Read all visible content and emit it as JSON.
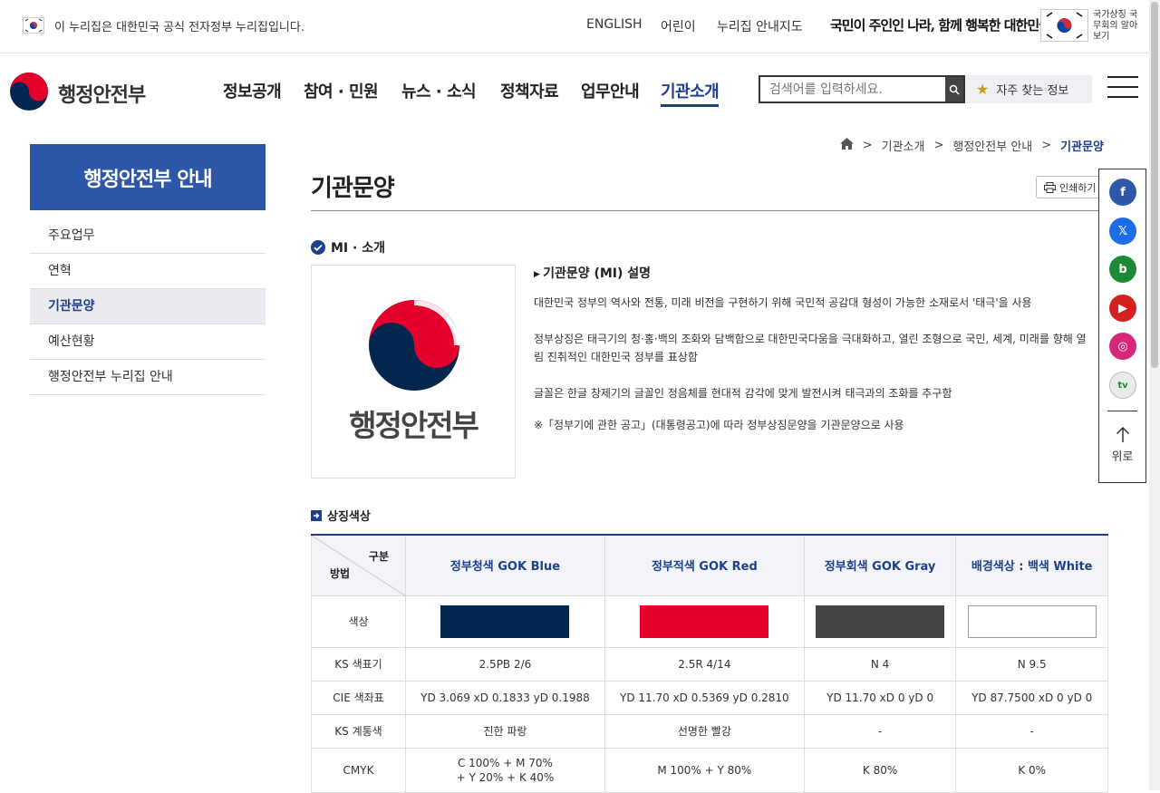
{
  "topbar": {
    "official_notice": "이 누리집은 대한민국 공식 전자정부 누리집입니다.",
    "links": [
      "ENGLISH",
      "어린이",
      "누리집 안내지도"
    ],
    "slogan": "국민이 주인인 나라, 함께 행복한 대한민국",
    "cabinet_label": "국가상징 국무회의 알아보기"
  },
  "header": {
    "logo_text": "행정안전부",
    "gnb": [
      "정보공개",
      "참여 · 민원",
      "뉴스 · 소식",
      "정책자료",
      "업무안내",
      "기관소개"
    ],
    "search_placeholder": "검색어를 입력하세요.",
    "frequent_label": "자주 찾는 정보"
  },
  "lnb": {
    "title": "행정안전부 안내",
    "items": [
      "주요업무",
      "연혁",
      "기관문양",
      "예산현황",
      "행정안전부 누리집 안내"
    ],
    "active_index": 2
  },
  "breadcrumb": [
    "기관소개",
    "행정안전부 안내",
    "기관문양"
  ],
  "page": {
    "title": "기관문양",
    "print_label": "인쇄하기",
    "section_mi": "MI · 소개",
    "logo_caption": "행정안전부",
    "desc_head": "기관문양 (MI) 설명",
    "desc": [
      "대한민국 정부의 역사와 전통, 미래 비전을 구현하기 위해 국민적 공감대 형성이 가능한 소재로서 '태극'을 사용",
      "정부상징은 태극기의 청·홍·백의 조화와 담백함으로 대한민국다움을 극대화하고, 열린 조형으로 국민, 세계, 미래를 향해 열림 진취적인 대한민국 정부를 표상함",
      "글꼴은 한글 창제기의 글꼴인 정음체를 현대적 감각에 맞게 발전시켜 태극과의 조화를 추구함",
      "※「정부기에 관한 공고」(대통령공고)에 따라 정부상징문양을 기관문양으로 사용"
    ],
    "section_color": "상징색상"
  },
  "table": {
    "corner_top": "구분",
    "corner_bottom": "방법",
    "columns": [
      "정부청색 GOK Blue",
      "정부적색 GOK Red",
      "정부회색 GOK Gray",
      "배경색상 : 백색 White"
    ],
    "swatch_colors": [
      "#02274f",
      "#e4002b",
      "#444447",
      "#ffffff"
    ],
    "rows": [
      {
        "label": "색상",
        "values": [
          "",
          "",
          "",
          ""
        ]
      },
      {
        "label": "KS 색표기",
        "values": [
          "2.5PB 2/6",
          "2.5R 4/14",
          "N 4",
          "N 9.5"
        ]
      },
      {
        "label": "CIE 색좌표",
        "values": [
          "YD 3.069 xD 0.1833 yD 0.1988",
          "YD 11.70 xD 0.5369 yD 0.2810",
          "YD 11.70 xD 0 yD 0",
          "YD 87.7500 xD 0 yD 0"
        ]
      },
      {
        "label": "KS 계통색",
        "values": [
          "진한 파랑",
          "선명한 빨강",
          "-",
          "-"
        ]
      },
      {
        "label": "CMYK",
        "values": [
          "C 100% + M 70% + Y 20% + K 40%",
          "M 100% + Y 80%",
          "K 80%",
          "K 0%"
        ]
      }
    ]
  },
  "sidebar": {
    "sns": [
      {
        "name": "facebook",
        "glyph": "f",
        "color": "#2f57a8"
      },
      {
        "name": "x",
        "glyph": "𝕏",
        "color": "#1c6ee8"
      },
      {
        "name": "blog",
        "glyph": "b",
        "color": "#1d8a35"
      },
      {
        "name": "youtube",
        "glyph": "▶",
        "color": "#d61f1f"
      },
      {
        "name": "instagram",
        "glyph": "◎",
        "color": "#d6287b"
      },
      {
        "name": "tv",
        "glyph": "tv",
        "color": "#e8ece8"
      }
    ],
    "top_label": "위로"
  }
}
